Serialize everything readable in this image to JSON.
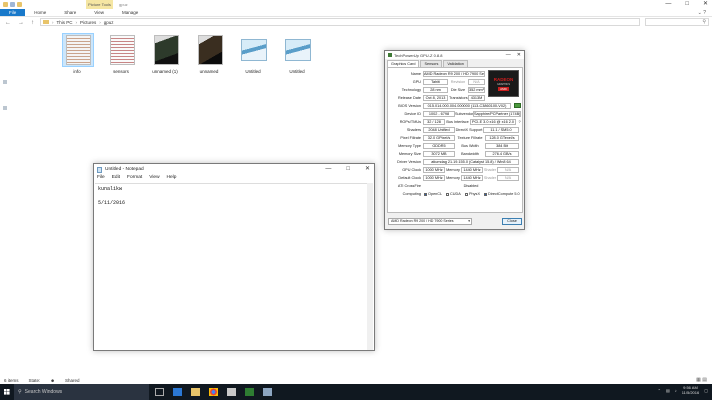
{
  "explorer": {
    "title": "gpuz",
    "context_tab": "Picture Tools",
    "ribbon_tabs": [
      "File",
      "Home",
      "Share",
      "View",
      "Manage"
    ],
    "breadcrumb": [
      "This PC",
      "Pictures",
      "gpuz"
    ],
    "search_icon": "search-icon",
    "files": [
      {
        "name": "info",
        "thumb": "doc",
        "selected": true
      },
      {
        "name": "sensors",
        "thumb": "doc2",
        "selected": false
      },
      {
        "name": "unnamed (1)",
        "thumb": "photo",
        "selected": false
      },
      {
        "name": "unnamed",
        "thumb": "photo2",
        "selected": false
      },
      {
        "name": "Untitled",
        "thumb": "untitled",
        "selected": false
      },
      {
        "name": "Untitled",
        "thumb": "untitled",
        "selected": false
      }
    ],
    "status": {
      "items": "6 items",
      "state_label": "State:",
      "state_value": "Shared"
    }
  },
  "notepad": {
    "title": "Untitled - Notepad",
    "menu": [
      "File",
      "Edit",
      "Format",
      "View",
      "Help"
    ],
    "lines": [
      "kunalikw",
      "",
      "5/11/2016"
    ]
  },
  "gpuz": {
    "title": "TechPowerUp GPU-Z 0.8.8",
    "tabs": [
      "Graphics Card",
      "Sensors",
      "Validation"
    ],
    "name": "AMD Radeon R9 200 / HD 7900 Series",
    "gpu": "Tahiti",
    "revision_label": "Revision",
    "revision": "N/A",
    "technology": "28 nm",
    "die_size_label": "Die Size",
    "die_size": "352 mm²",
    "release_date": "Oct 8, 2013",
    "transistors_label": "Transistors",
    "transistors": "4313M",
    "bios_version": "015.014.000.004.000000 (113-C3860100-V02)",
    "device_id": "1002 - 6798",
    "subvendor_label": "Subvendor",
    "subvendor": "Sapphire/PCPartner (174B)",
    "rops_tmus": "32 / 128",
    "bus_interface_label": "Bus Interface",
    "bus_interface": "PCI-E 3.0 x16 @ x16 2.0",
    "shaders": "2048 Unified",
    "directx_label": "DirectX Support",
    "directx": "11.1 / SM5.0",
    "pixel_fillrate": "32.0 GPixel/s",
    "texture_fillrate_label": "Texture Fillrate",
    "texture_fillrate": "128.0 GTexel/s",
    "memory_type": "GDDR5",
    "bus_width_label": "Bus Width",
    "bus_width": "384 Bit",
    "memory_size": "3072 MB",
    "bandwidth_label": "Bandwidth",
    "bandwidth": "276.4 GB/s",
    "driver_version": "atiumdag 21.19.155.0 (Catalyst 15.8) / Win8 64",
    "gpu_clock": "1000 MHz",
    "memory_label": "Memory",
    "gpu_mem_clock": "1440 MHz",
    "shader_label": "Shader",
    "shader_clock": "N/A",
    "default_clock": "1000 MHz",
    "default_mem_clock": "1440 MHz",
    "default_shader": "N/A",
    "crossfire": "Disabled",
    "computing": [
      "OpenCL",
      "CUDA",
      "PhysX",
      "DirectCompute 5.0"
    ],
    "computing_checked": [
      true,
      false,
      false,
      true
    ],
    "labels": {
      "name": "Name",
      "gpu": "GPU",
      "technology": "Technology",
      "release_date": "Release Date",
      "bios_version": "BIOS Version",
      "device_id": "Device ID",
      "rops_tmus": "ROPs/TMUs",
      "shaders": "Shaders",
      "pixel_fillrate": "Pixel Fillrate",
      "memory_type": "Memory Type",
      "memory_size": "Memory Size",
      "driver_version": "Driver Version",
      "gpu_clock": "GPU Clock",
      "default_clock": "Default Clock",
      "crossfire": "ATI CrossFire",
      "computing": "Computing"
    },
    "logo": {
      "brand": "RADEON",
      "sub": "GRAPHICS",
      "vendor": "AMD"
    },
    "selected_card": "AMD Radeon R9 200 / HD 7900 Series",
    "close_label": "Close"
  },
  "taskbar": {
    "search_placeholder": "Search Windows",
    "time": "9:56 AM",
    "date": "11/5/2016"
  },
  "colors": {
    "accent": "#1979ca",
    "taskbar": "#101820",
    "radeon_red": "#d21c1c"
  }
}
